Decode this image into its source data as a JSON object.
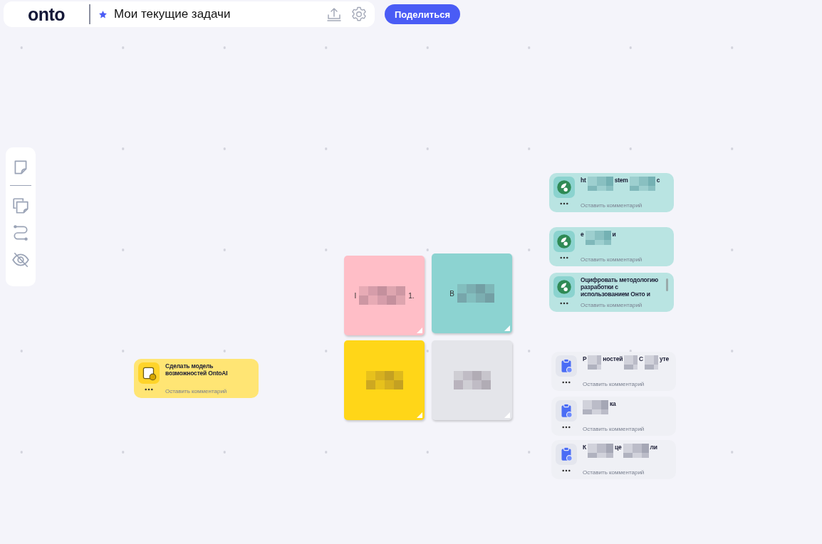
{
  "header": {
    "logo": "onto",
    "starred": true,
    "title": "Мои текущие задачи",
    "share_button": "Поделиться"
  },
  "toolbar": [
    {
      "kind": "sticky"
    },
    {
      "kind": "divider"
    },
    {
      "kind": "stack"
    },
    {
      "kind": "connector"
    },
    {
      "kind": "hide"
    }
  ],
  "stickies": [
    {
      "color": "#ffbec7",
      "fragments": [
        "I",
        "1."
      ]
    },
    {
      "color": "#8cd3d1",
      "fragments": [
        "В"
      ]
    },
    {
      "color": "#ffd618"
    },
    {
      "color": "#e4e5ea"
    }
  ],
  "cards": [
    {
      "kind": "idea",
      "color": "#ffe574",
      "title": "Сделать модель возможностей OntoAI",
      "comment": "Оставить комментарий"
    },
    {
      "kind": "leaf",
      "color": "#b9e4e2",
      "fragments": [
        "ht",
        "stem",
        "с"
      ],
      "comment": "Оставить комментарий"
    },
    {
      "kind": "leaf",
      "color": "#b9e4e2",
      "fragments": [
        "е",
        "и"
      ],
      "comment": "Оставить комментарий"
    },
    {
      "kind": "leaf",
      "color": "#b9e4e2",
      "title": "Оцифровать методологию разработки с использованием Онто и",
      "comment": "Оставить комментарий"
    },
    {
      "kind": "task",
      "color": "#eff0f5",
      "fragments": [
        "Р",
        "ностей",
        "С",
        "уте"
      ],
      "comment": "Оставить комментарий"
    },
    {
      "kind": "task",
      "color": "#eff0f5",
      "fragments": [
        "ка"
      ],
      "comment": "Оставить комментарий"
    },
    {
      "kind": "task",
      "color": "#eff0f5",
      "fragments": [
        "К",
        "це",
        "ли"
      ],
      "comment": "Оставить комментарий"
    }
  ]
}
